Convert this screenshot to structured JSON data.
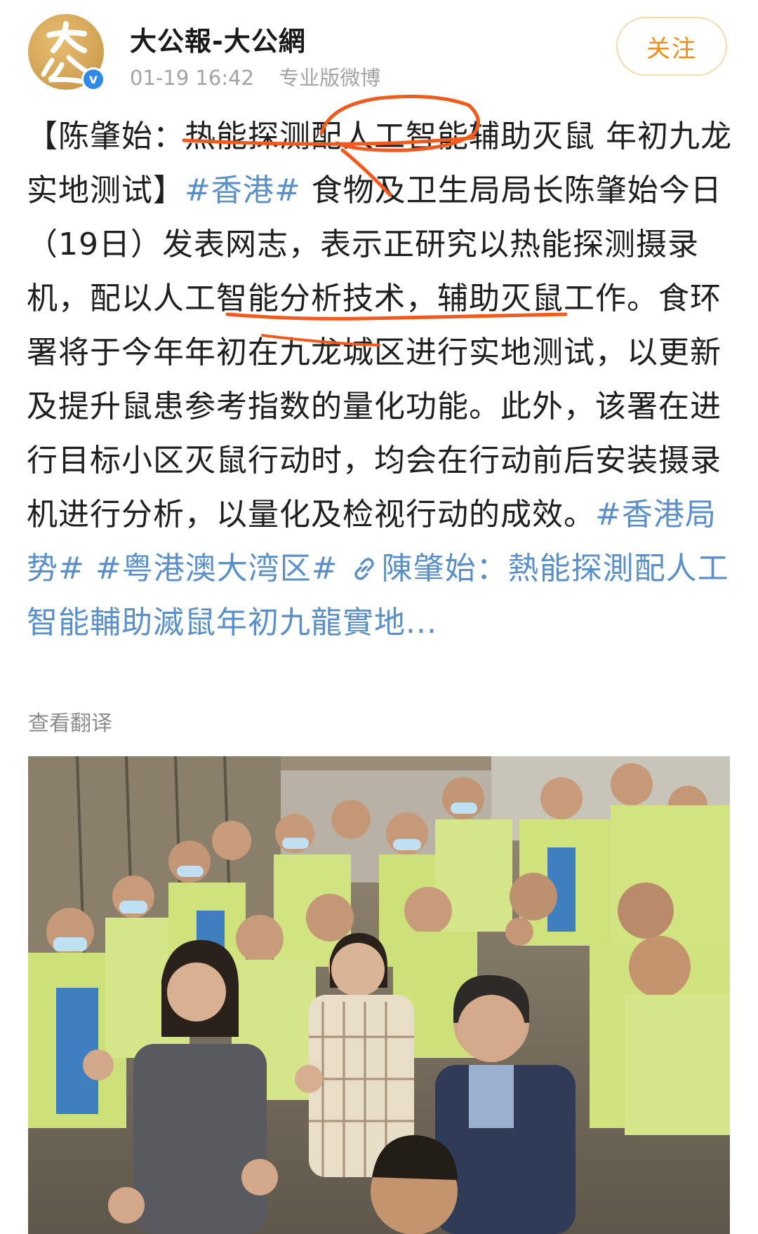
{
  "account": {
    "name": "大公報-大公網",
    "avatar_text": "大公",
    "verified_mark": "v"
  },
  "meta": {
    "timestamp": "01-19 16:42",
    "source": "专业版微博"
  },
  "follow_label": "关注",
  "post": {
    "seg1": "【陈肇始：热能探测配人工智能辅助灭鼠 年初九龙实地测试】",
    "tag1": "#香港#",
    "seg2": " 食物及卫生局局长陈肇始今日（19日）发表网志，表示正研究以热能探测摄录机，配以人工智能分析技术，辅助灭鼠工作。食环署将于今年年初在九龙城区进行实地测试，以更新及提升鼠患参考指数的量化功能。此外，该署在进行目标小区灭鼠行动时，均会在行动前后安装摄录机进行分析，以量化及检视行动的成效。",
    "tag2": "#香港局势#",
    "tag3": "#粤港澳大湾区#",
    "link_icon": "link-icon",
    "link_text": "陳肇始：熱能探測配人工智能輔助滅鼠年初九龍實地..."
  },
  "translate_label": "查看翻译",
  "colors": {
    "hashtag": "#5b8fc7",
    "follow_text": "#f08c1c",
    "annotation": "#f05a1c",
    "meta": "#a4a4a4"
  },
  "photo": {
    "description_icon": "group-photo"
  }
}
